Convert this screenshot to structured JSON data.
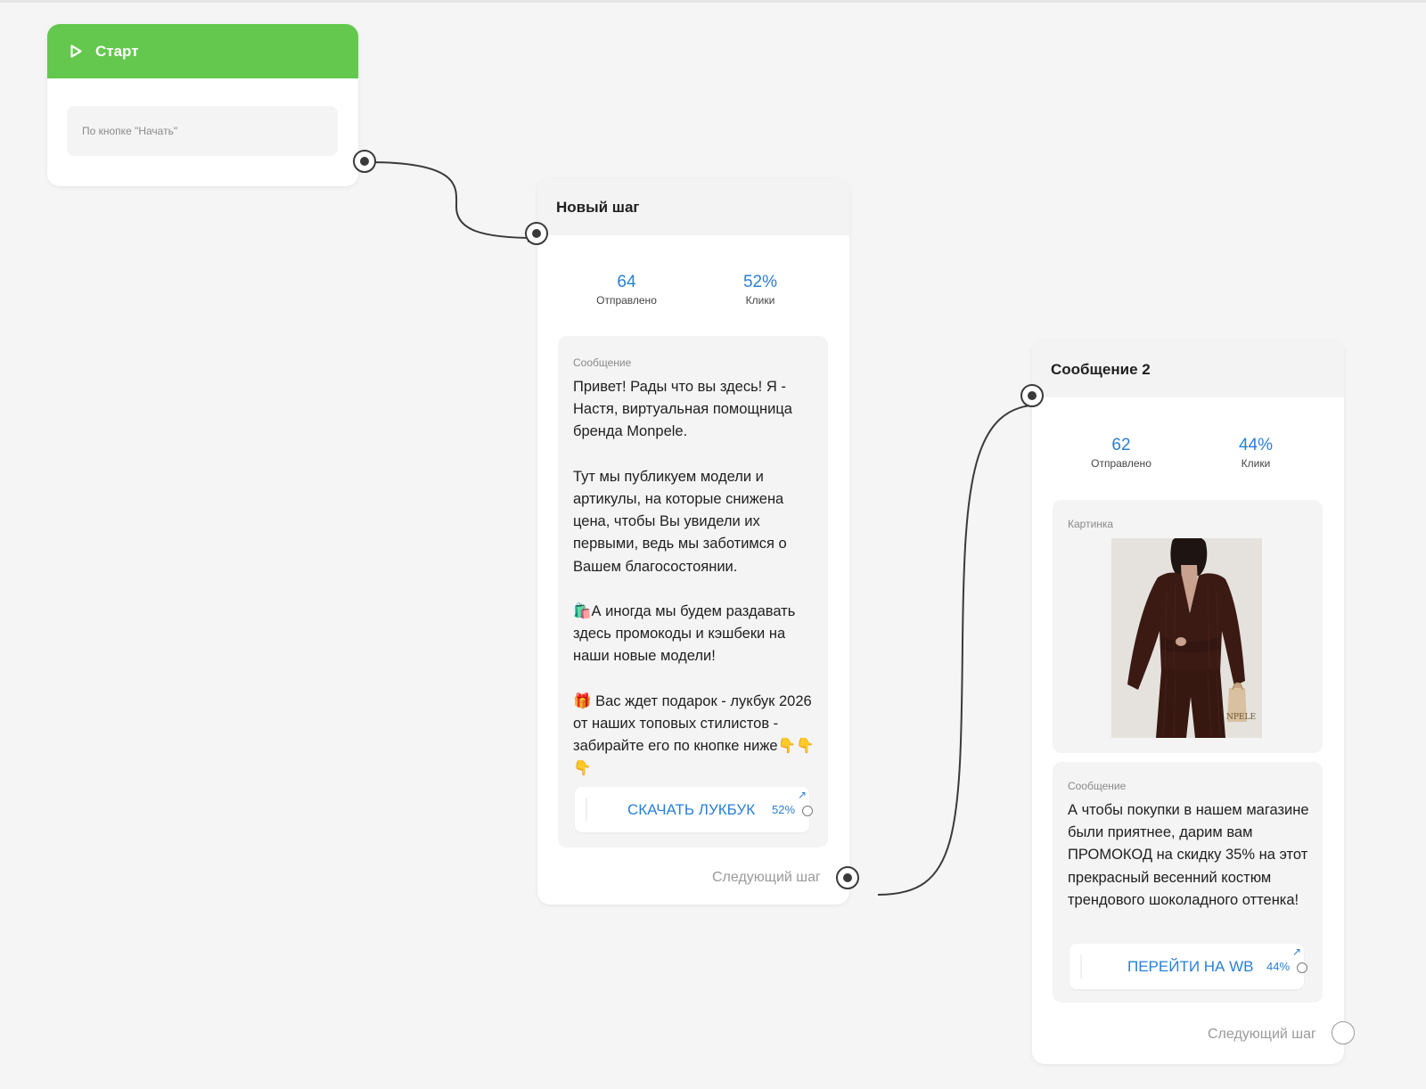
{
  "start": {
    "title": "Старт",
    "trigger": "По кнопке \"Начать\""
  },
  "step1": {
    "title": "Новый шаг",
    "stats": [
      {
        "value": "64",
        "label": "Отправлено"
      },
      {
        "value": "52%",
        "label": "Клики"
      }
    ],
    "message": {
      "label": "Сообщение",
      "paragraphs": [
        "Привет! Рады что вы здесь! Я - Настя, виртуальная помощница бренда Monpele.",
        "Тут мы публикуем модели и артикулы, на которые снижена цена, чтобы Вы увидели их первыми, ведь мы заботимся о Вашем благосостоянии.",
        "🛍️А иногда мы будем раздавать здесь промокоды и кэшбеки на наши новые модели!",
        "🎁 Вас ждет подарок - лукбук 2026 от наших топовых стилистов - забирайте его по кнопке ниже👇👇👇"
      ],
      "button": {
        "label": "СКАЧАТЬ ЛУКБУК",
        "percent": "52%",
        "link_icon": "arrow-up-right-icon"
      }
    },
    "next_label": "Следующий шаг"
  },
  "step2": {
    "title": "Сообщение 2",
    "stats": [
      {
        "value": "62",
        "label": "Отправлено"
      },
      {
        "value": "44%",
        "label": "Клики"
      }
    ],
    "image_block": {
      "label": "Картинка",
      "watermark": "NPELE"
    },
    "message": {
      "label": "Сообщение",
      "paragraphs": [
        "А чтобы покупки в нашем магазине были приятнее, дарим вам ПРОМОКОД на скидку 35% на этот прекрасный весенний костюм трендового шоколадного оттенка!"
      ],
      "button": {
        "label": "ПЕРЕЙТИ НА WB",
        "percent": "44%",
        "link_icon": "arrow-up-right-icon"
      }
    },
    "next_label": "Следующий шаг"
  },
  "colors": {
    "start_header": "#63c84d",
    "accent": "#2a7fd6",
    "canvas": "#f5f5f5",
    "edge": "#3a3a3a"
  }
}
